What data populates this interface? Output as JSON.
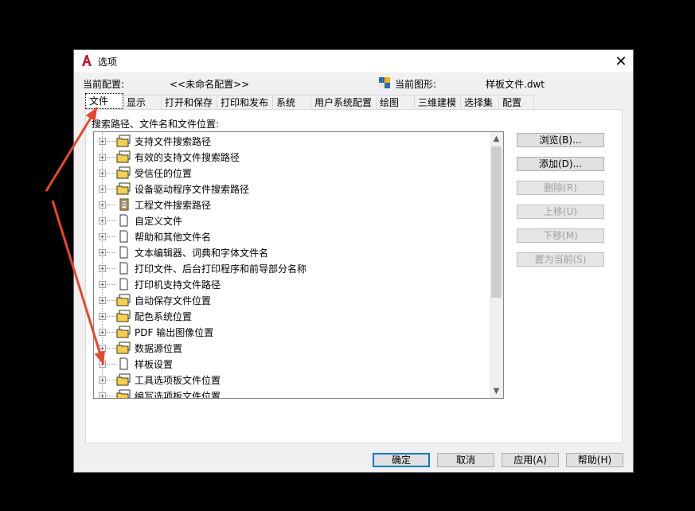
{
  "window": {
    "title": "选项"
  },
  "info": {
    "current_profile_label": "当前配置:",
    "current_profile_value": "<<未命名配置>>",
    "current_drawing_label": "当前图形:",
    "current_drawing_value": "样板文件.dwt"
  },
  "tabs": [
    "文件",
    "显示",
    "打开和保存",
    "打印和发布",
    "系统",
    "用户系统配置",
    "绘图",
    "三维建模",
    "选择集",
    "配置"
  ],
  "active_tab": 0,
  "panel": {
    "section_label": "搜索路径、文件名和文件位置:"
  },
  "tree_items": [
    {
      "label": "支持文件搜索路径",
      "icon": "folder-stack-icon"
    },
    {
      "label": "有效的支持文件搜索路径",
      "icon": "folder-stack-icon"
    },
    {
      "label": "受信任的位置",
      "icon": "folder-stack-icon"
    },
    {
      "label": "设备驱动程序文件搜索路径",
      "icon": "folder-stack-icon"
    },
    {
      "label": "工程文件搜索路径",
      "icon": "project-file-icon"
    },
    {
      "label": "自定义文件",
      "icon": "document-icon"
    },
    {
      "label": "帮助和其他文件名",
      "icon": "document-icon"
    },
    {
      "label": "文本编辑器、词典和字体文件名",
      "icon": "document-icon"
    },
    {
      "label": "打印文件、后台打印程序和前导部分名称",
      "icon": "document-icon"
    },
    {
      "label": "打印机支持文件路径",
      "icon": "document-icon"
    },
    {
      "label": "自动保存文件位置",
      "icon": "folder-stack-icon"
    },
    {
      "label": "配色系统位置",
      "icon": "folder-stack-icon"
    },
    {
      "label": "PDF 输出图像位置",
      "icon": "folder-stack-icon"
    },
    {
      "label": "数据源位置",
      "icon": "folder-stack-icon"
    },
    {
      "label": "样板设置",
      "icon": "document-icon"
    },
    {
      "label": "工具选项板文件位置",
      "icon": "folder-stack-icon"
    },
    {
      "label": "编写选项板文件位置",
      "icon": "folder-stack-icon"
    }
  ],
  "side_buttons": [
    {
      "label": "浏览(B)...",
      "enabled": true
    },
    {
      "label": "添加(D)...",
      "enabled": true
    },
    {
      "label": "删除(R)",
      "enabled": false
    },
    {
      "label": "上移(U)",
      "enabled": false
    },
    {
      "label": "下移(M)",
      "enabled": false
    },
    {
      "label": "置为当前(S)",
      "enabled": false
    }
  ],
  "bottom_buttons": {
    "ok": "确定",
    "cancel": "取消",
    "apply": "应用(A)",
    "help": "帮助(H)"
  },
  "colors": {
    "annotation_arrow": "#e8472b",
    "app_icon_red": "#c8102e",
    "folder_yellow": "#f7d046",
    "focus_blue": "#0078d7"
  }
}
